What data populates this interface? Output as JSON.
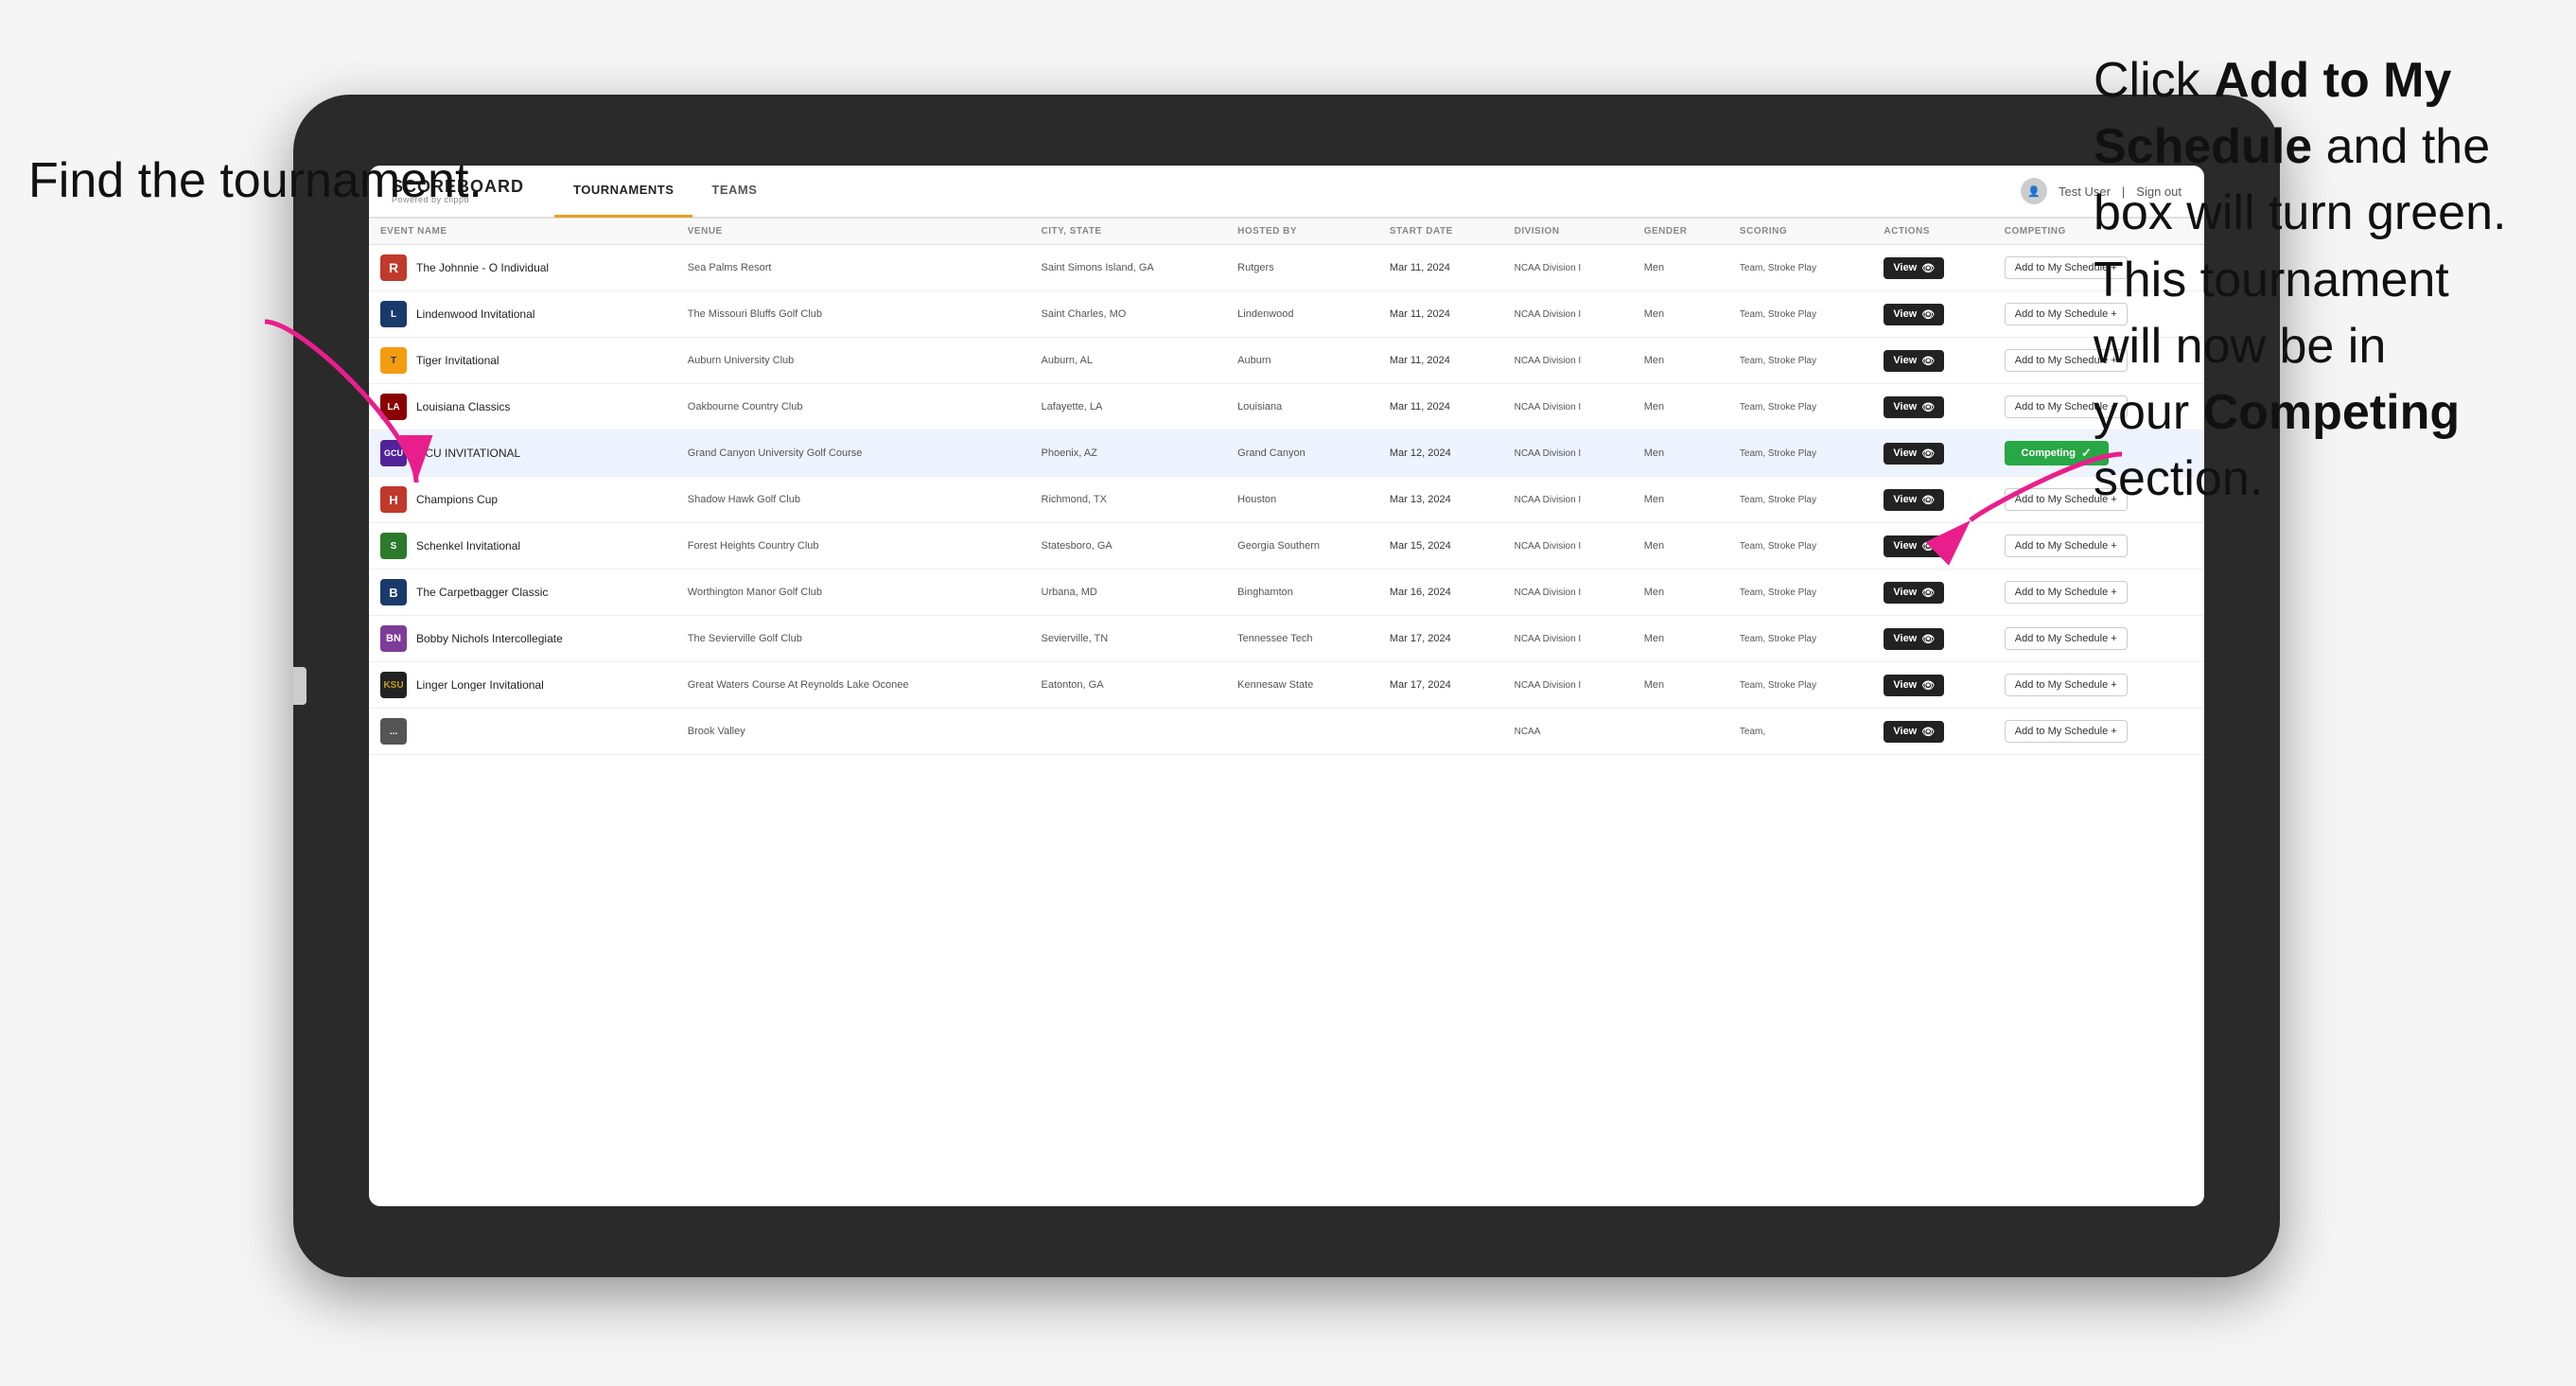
{
  "annotations": {
    "left": "Find the\ntournament.",
    "right_line1": "Click ",
    "right_bold1": "Add to My\nSchedule",
    "right_line2": " and the\nbox will turn green.\nThis tournament\nwill now be in\nyour ",
    "right_bold2": "Competing",
    "right_line3": "\nsection."
  },
  "header": {
    "logo": "SCOREBOARD",
    "logo_sub": "Powered by clippd",
    "tabs": [
      {
        "label": "TOURNAMENTS",
        "active": true
      },
      {
        "label": "TEAMS",
        "active": false
      }
    ],
    "user_label": "Test User",
    "sign_out": "Sign out"
  },
  "table": {
    "columns": [
      "EVENT NAME",
      "VENUE",
      "CITY, STATE",
      "HOSTED BY",
      "START DATE",
      "DIVISION",
      "GENDER",
      "SCORING",
      "ACTIONS",
      "COMPETING"
    ],
    "rows": [
      {
        "logo": "R",
        "logo_class": "logo-r",
        "event": "The Johnnie - O Individual",
        "venue": "Sea Palms Resort",
        "city": "Saint Simons Island, GA",
        "hosted": "Rutgers",
        "date": "Mar 11, 2024",
        "division": "NCAA Division I",
        "gender": "Men",
        "scoring": "Team, Stroke Play",
        "competing": "add",
        "competing_label": "Add to My Schedule +",
        "highlighted": false
      },
      {
        "logo": "L",
        "logo_class": "logo-l",
        "event": "Lindenwood Invitational",
        "venue": "The Missouri Bluffs Golf Club",
        "city": "Saint Charles, MO",
        "hosted": "Lindenwood",
        "date": "Mar 11, 2024",
        "division": "NCAA Division I",
        "gender": "Men",
        "scoring": "Team, Stroke Play",
        "competing": "add",
        "competing_label": "Add to My Schedule +",
        "highlighted": false
      },
      {
        "logo": "T",
        "logo_class": "logo-tiger",
        "event": "Tiger Invitational",
        "venue": "Auburn University Club",
        "city": "Auburn, AL",
        "hosted": "Auburn",
        "date": "Mar 11, 2024",
        "division": "NCAA Division I",
        "gender": "Men",
        "scoring": "Team, Stroke Play",
        "competing": "add",
        "competing_label": "Add to My Schedule +",
        "highlighted": false
      },
      {
        "logo": "LA",
        "logo_class": "logo-la",
        "event": "Louisiana Classics",
        "venue": "Oakbourne Country Club",
        "city": "Lafayette, LA",
        "hosted": "Louisiana",
        "date": "Mar 11, 2024",
        "division": "NCAA Division I",
        "gender": "Men",
        "scoring": "Team, Stroke Play",
        "competing": "add",
        "competing_label": "Add to My Schedule +",
        "highlighted": false
      },
      {
        "logo": "GCU",
        "logo_class": "logo-gcu",
        "event": "GCU INVITATIONAL",
        "venue": "Grand Canyon University Golf Course",
        "city": "Phoenix, AZ",
        "hosted": "Grand Canyon",
        "date": "Mar 12, 2024",
        "division": "NCAA Division I",
        "gender": "Men",
        "scoring": "Team, Stroke Play",
        "competing": "competing",
        "competing_label": "Competing ✓",
        "highlighted": true
      },
      {
        "logo": "H",
        "logo_class": "logo-h",
        "event": "Champions Cup",
        "venue": "Shadow Hawk Golf Club",
        "city": "Richmond, TX",
        "hosted": "Houston",
        "date": "Mar 13, 2024",
        "division": "NCAA Division I",
        "gender": "Men",
        "scoring": "Team, Stroke Play",
        "competing": "add",
        "competing_label": "Add to My Schedule +",
        "highlighted": false
      },
      {
        "logo": "S",
        "logo_class": "logo-s",
        "event": "Schenkel Invitational",
        "venue": "Forest Heights Country Club",
        "city": "Statesboro, GA",
        "hosted": "Georgia Southern",
        "date": "Mar 15, 2024",
        "division": "NCAA Division I",
        "gender": "Men",
        "scoring": "Team, Stroke Play",
        "competing": "add",
        "competing_label": "Add to My Schedule +",
        "highlighted": false
      },
      {
        "logo": "B",
        "logo_class": "logo-b",
        "event": "The Carpetbagger Classic",
        "venue": "Worthington Manor Golf Club",
        "city": "Urbana, MD",
        "hosted": "Binghamton",
        "date": "Mar 16, 2024",
        "division": "NCAA Division I",
        "gender": "Men",
        "scoring": "Team, Stroke Play",
        "competing": "add",
        "competing_label": "Add to My Schedule +",
        "highlighted": false
      },
      {
        "logo": "BN",
        "logo_class": "logo-bk",
        "event": "Bobby Nichols Intercollegiate",
        "venue": "The Sevierville Golf Club",
        "city": "Sevierville, TN",
        "hosted": "Tennessee Tech",
        "date": "Mar 17, 2024",
        "division": "NCAA Division I",
        "gender": "Men",
        "scoring": "Team, Stroke Play",
        "competing": "add",
        "competing_label": "Add to My Schedule +",
        "highlighted": false
      },
      {
        "logo": "KSU",
        "logo_class": "logo-ksu",
        "event": "Linger Longer Invitational",
        "venue": "Great Waters Course At Reynolds Lake Oconee",
        "city": "Eatonton, GA",
        "hosted": "Kennesaw State",
        "date": "Mar 17, 2024",
        "division": "NCAA Division I",
        "gender": "Men",
        "scoring": "Team, Stroke Play",
        "competing": "add",
        "competing_label": "Add to My Schedule +",
        "highlighted": false
      },
      {
        "logo": "...",
        "logo_class": "logo-last",
        "event": "",
        "venue": "Brook Valley",
        "city": "",
        "hosted": "",
        "date": "",
        "division": "NCAA",
        "gender": "",
        "scoring": "Team,",
        "competing": "add",
        "competing_label": "Add to My Schedule +",
        "highlighted": false
      }
    ]
  }
}
